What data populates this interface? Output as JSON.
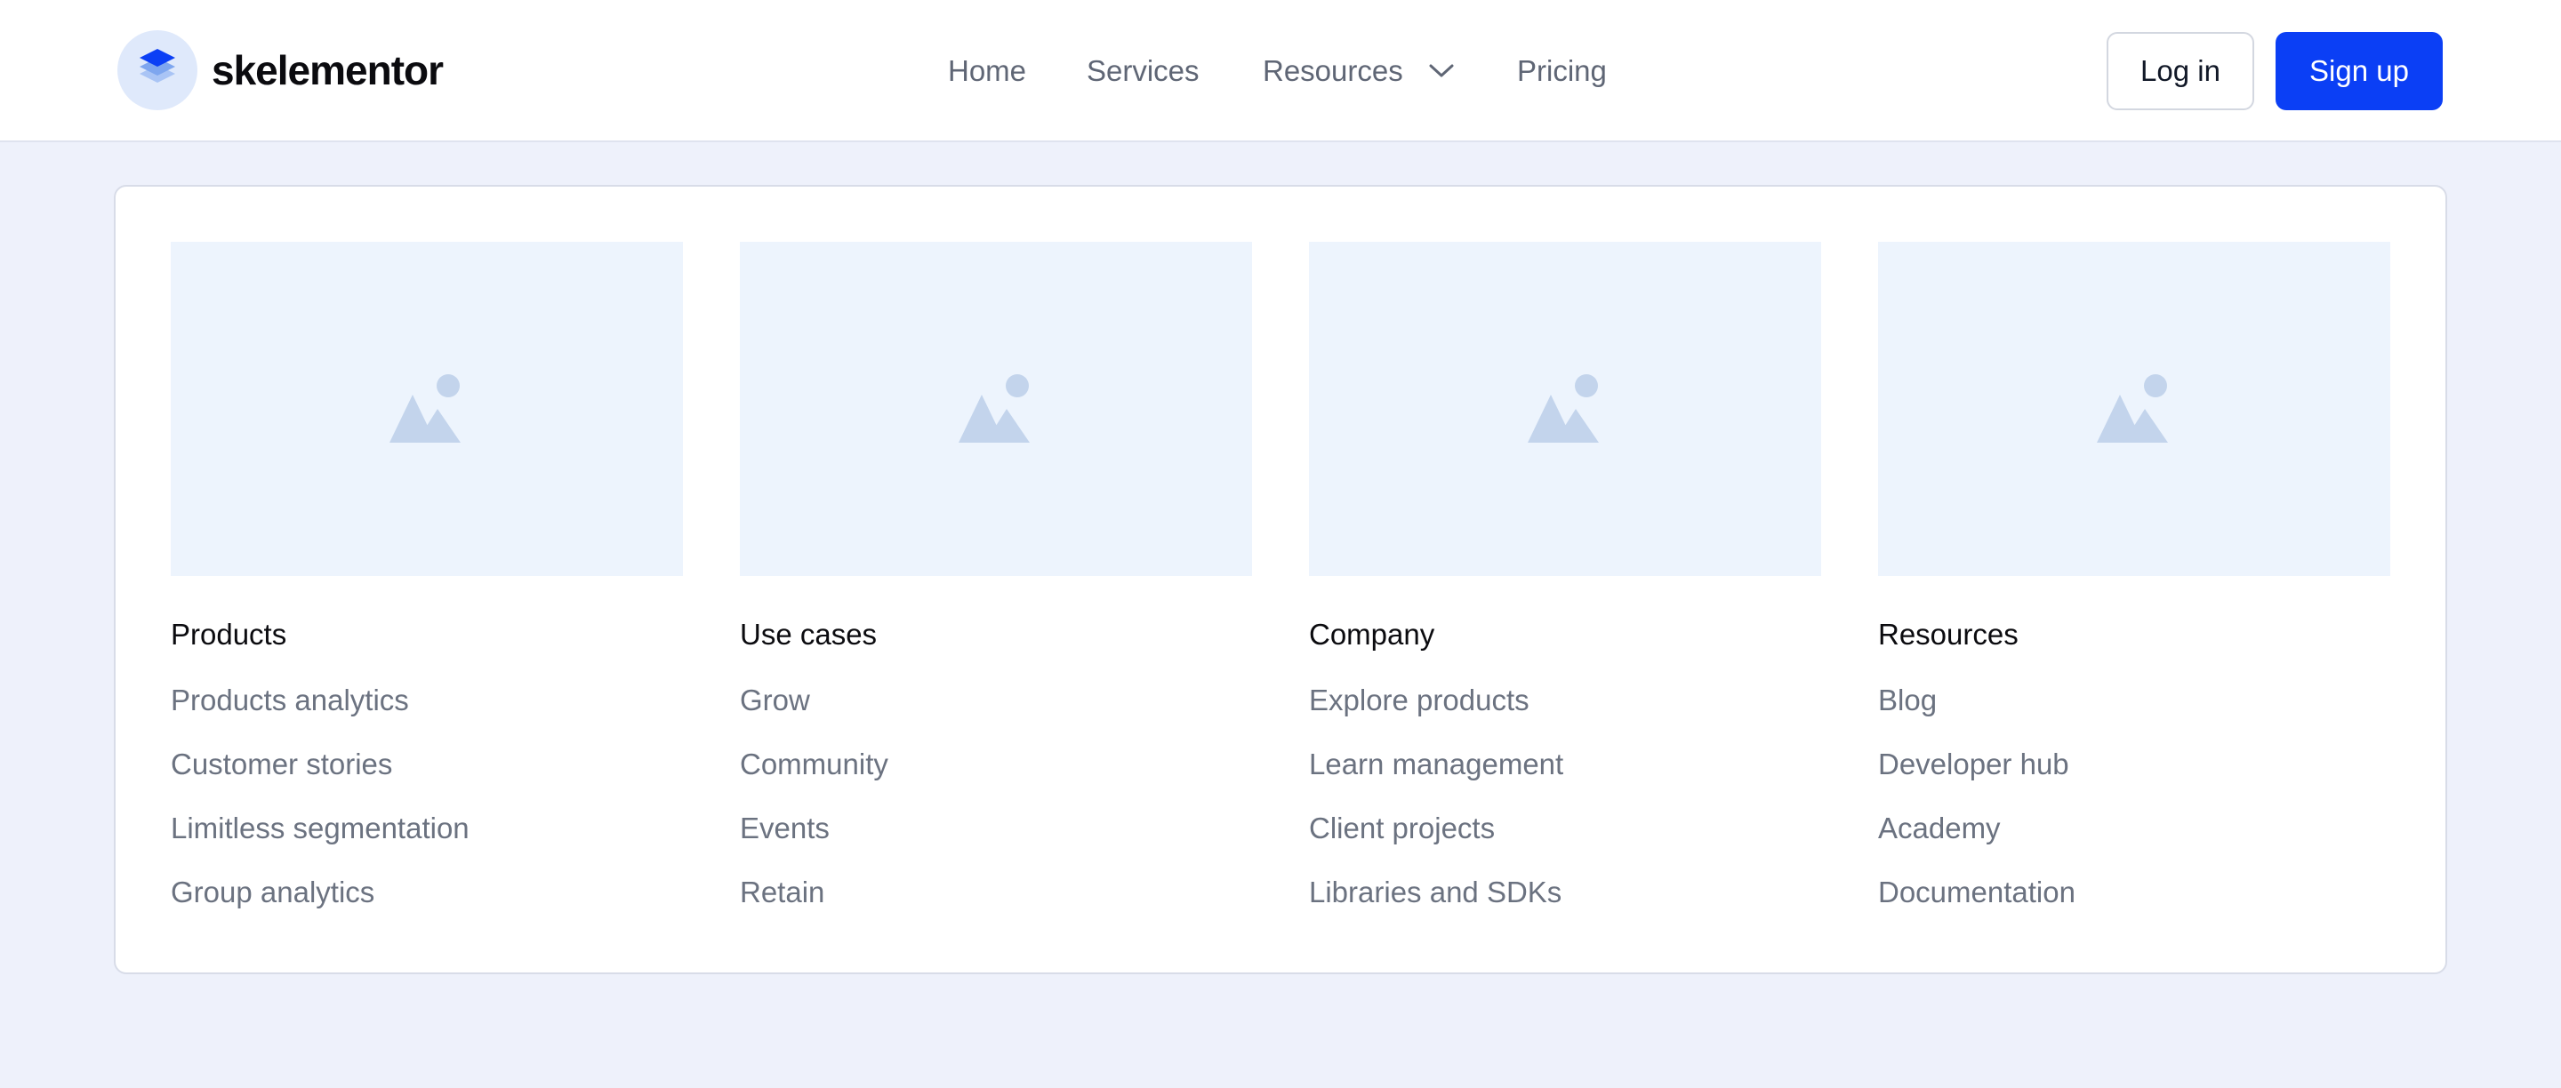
{
  "brand": {
    "name": "skelementor",
    "logo_icon": "layers-icon",
    "accent": "#0b3ff5"
  },
  "nav": {
    "items": [
      {
        "label": "Home"
      },
      {
        "label": "Services"
      },
      {
        "label": "Resources",
        "icon": "chevron-down-icon"
      },
      {
        "label": "Pricing"
      }
    ]
  },
  "auth": {
    "login_label": "Log in",
    "signup_label": "Sign up"
  },
  "menu": {
    "columns": [
      {
        "title": "Products",
        "image_icon": "image-placeholder-icon",
        "links": [
          "Products analytics",
          "Customer stories",
          "Limitless segmentation",
          "Group analytics"
        ]
      },
      {
        "title": "Use cases",
        "image_icon": "image-placeholder-icon",
        "links": [
          "Grow",
          "Community",
          "Events",
          "Retain"
        ]
      },
      {
        "title": "Company",
        "image_icon": "image-placeholder-icon",
        "links": [
          "Explore products",
          "Learn management",
          "Client projects",
          "Libraries and SDKs"
        ]
      },
      {
        "title": "Resources",
        "image_icon": "image-placeholder-icon",
        "links": [
          "Blog",
          "Developer hub",
          "Academy",
          "Documentation"
        ]
      }
    ]
  }
}
